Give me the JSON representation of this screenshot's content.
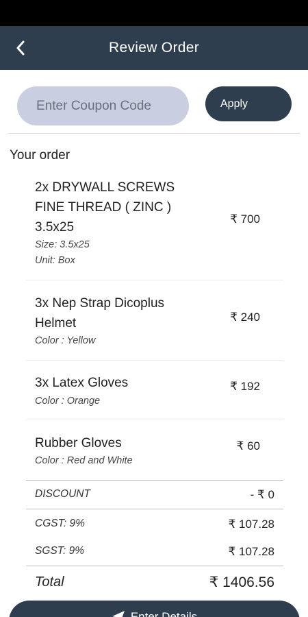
{
  "header": {
    "title": "Review Order",
    "back_icon": "chevron-left-icon"
  },
  "coupon": {
    "placeholder": "Enter Coupon Code",
    "value": "",
    "apply_label": "Apply"
  },
  "order": {
    "heading": "Your order",
    "items": [
      {
        "name": "2x DRYWALL SCREWS FINE THREAD ( ZINC ) 3.5x25",
        "meta": [
          "Size: 3.5x25",
          "Unit: Box"
        ],
        "price": "₹ 700"
      },
      {
        "name": "3x Nep Strap Dicoplus Helmet",
        "meta": [
          "Color : Yellow"
        ],
        "price": "₹ 240"
      },
      {
        "name": "3x Latex Gloves",
        "meta": [
          "Color : Orange"
        ],
        "price": "₹ 192"
      },
      {
        "name": "Rubber Gloves",
        "meta": [
          "Color : Red and White"
        ],
        "price": "₹ 60"
      }
    ]
  },
  "summary": {
    "discount_label": "DISCOUNT",
    "discount_value": "- ₹ 0",
    "cgst_label": "CGST: 9%",
    "cgst_value": "₹ 107.28",
    "sgst_label": "SGST: 9%",
    "sgst_value": "₹ 107.28",
    "total_label": "Total",
    "total_value": "₹ 1406.56"
  },
  "footer": {
    "button_label": "Enter Details",
    "button_icon": "send-icon"
  },
  "colors": {
    "primary": "#2e3e4f",
    "coupon_bg": "#c9cfe0",
    "status_bar": "#000000"
  }
}
